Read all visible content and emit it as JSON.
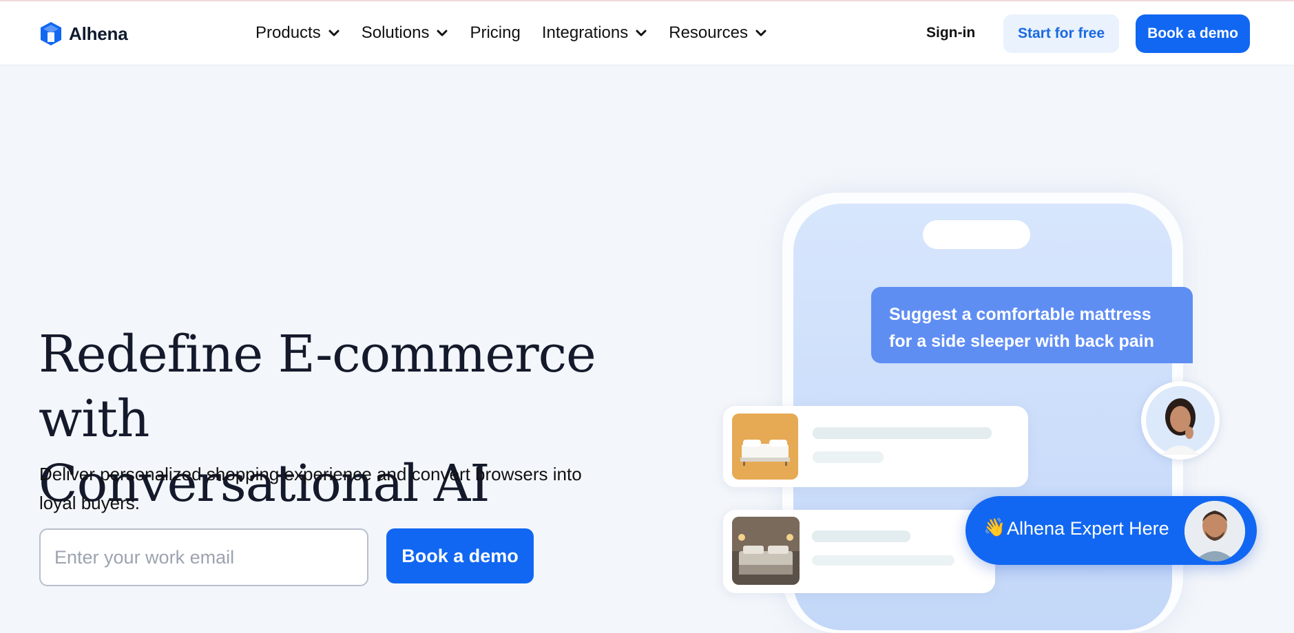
{
  "header": {
    "logo_text": "Alhena",
    "nav": [
      {
        "label": "Products",
        "has_dropdown": true
      },
      {
        "label": "Solutions",
        "has_dropdown": true
      },
      {
        "label": "Pricing",
        "has_dropdown": false
      },
      {
        "label": "Integrations",
        "has_dropdown": true
      },
      {
        "label": "Resources",
        "has_dropdown": true
      }
    ],
    "signin_label": "Sign-in",
    "start_free_label": "Start for free",
    "book_demo_label": "Book a demo"
  },
  "hero": {
    "title_line1": "Redefine E-commerce with",
    "title_line2": "Conversational AI",
    "subtitle_line1": "Deliver personalized shopping experience and convert browsers into",
    "subtitle_line2": "loyal buyers.",
    "email_placeholder": "Enter your work email",
    "cta_label": "Book a demo"
  },
  "mockup": {
    "chat_bubble_line1": "Suggest a comfortable mattress",
    "chat_bubble_line2": "for a side sleeper with back pain",
    "expert_wave": "👋",
    "expert_label": "Alhena Expert Here"
  },
  "colors": {
    "brand": "#1167f2",
    "background": "#f3f6fa",
    "bubble": "#5f8ef3"
  }
}
